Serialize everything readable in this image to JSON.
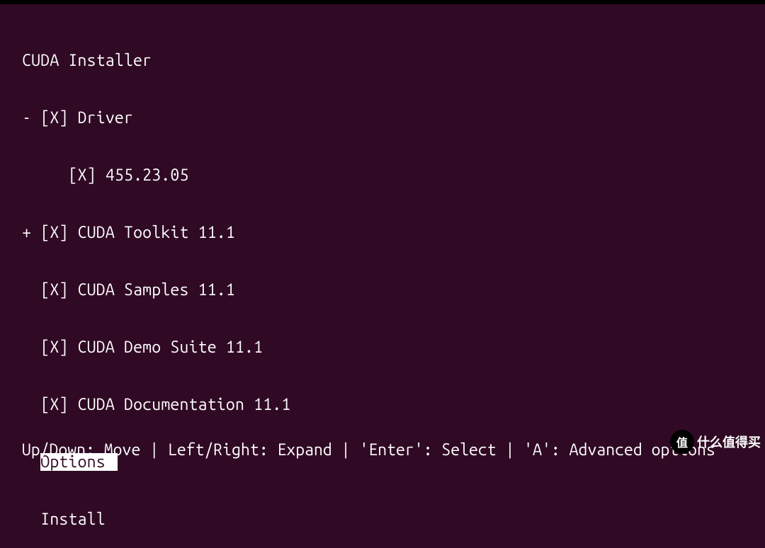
{
  "title": " CUDA Installer",
  "items": [
    {
      "prefix": " - ",
      "checkbox": "[X]",
      "label": "Driver",
      "name": "driver"
    },
    {
      "prefix": "      ",
      "checkbox": "[X]",
      "label": "455.23.05",
      "name": "driver-version"
    },
    {
      "prefix": " + ",
      "checkbox": "[X]",
      "label": "CUDA Toolkit 11.1",
      "name": "cuda-toolkit"
    },
    {
      "prefix": "   ",
      "checkbox": "[X]",
      "label": "CUDA Samples 11.1",
      "name": "cuda-samples"
    },
    {
      "prefix": "   ",
      "checkbox": "[X]",
      "label": "CUDA Demo Suite 11.1",
      "name": "cuda-demo-suite"
    },
    {
      "prefix": "   ",
      "checkbox": "[X]",
      "label": "CUDA Documentation 11.1",
      "name": "cuda-documentation"
    }
  ],
  "options_prefix": "   ",
  "options_label": "Options ",
  "install_prefix": "   ",
  "install_label": "Install",
  "footer": " Up/Down: Move | Left/Right: Expand | 'Enter': Select | 'A': Advanced options",
  "watermark": {
    "icon": "值",
    "text": "什么值得买"
  }
}
